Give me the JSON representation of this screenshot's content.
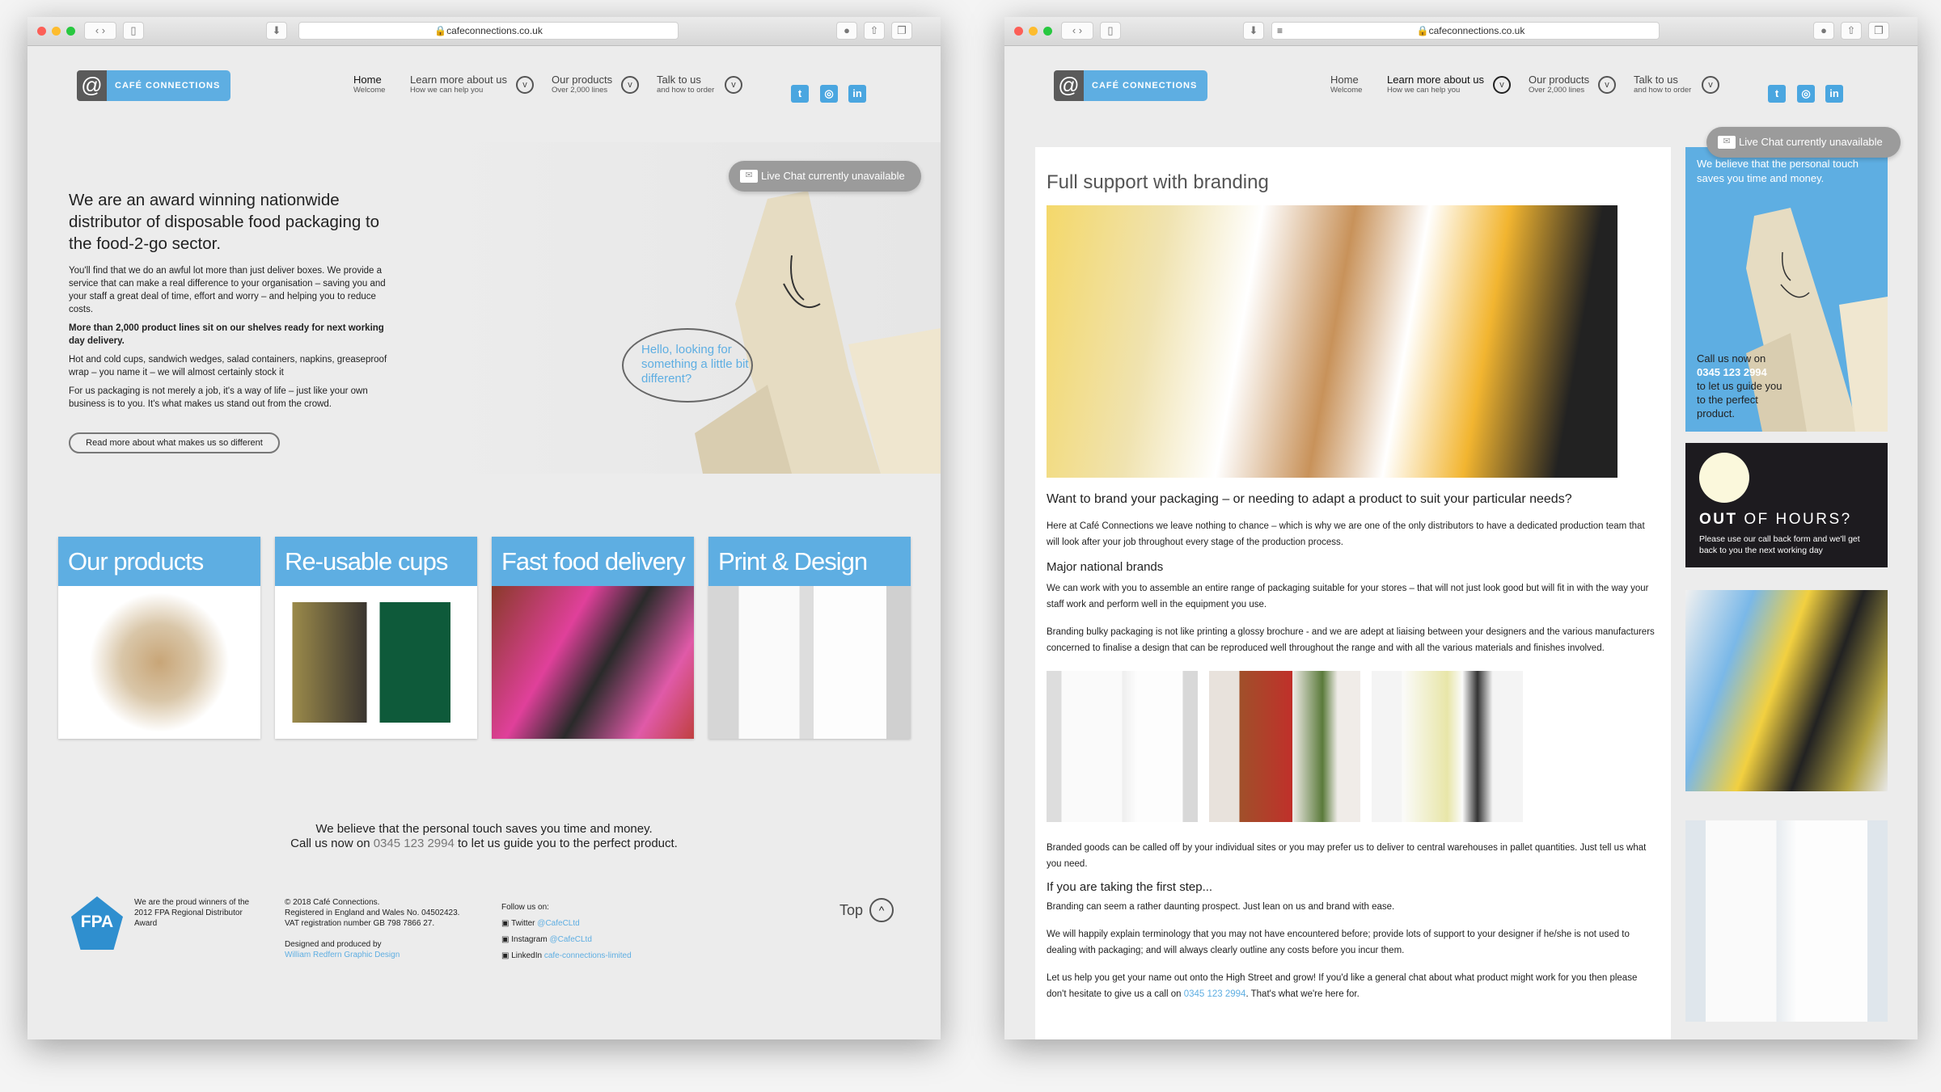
{
  "browser": {
    "url": "cafeconnections.co.uk"
  },
  "header": {
    "logo_text": "CAFÉ CONNECTIONS",
    "nav": [
      {
        "title": "Home",
        "subtitle": "Welcome"
      },
      {
        "title": "Learn more about us",
        "subtitle": "How we can help you"
      },
      {
        "title": "Our products",
        "subtitle": "Over 2,000 lines"
      },
      {
        "title": "Talk to us",
        "subtitle": "and how to order"
      }
    ],
    "social": [
      "twitter-icon",
      "instagram-icon",
      "linkedin-icon"
    ]
  },
  "live_chat": "Live Chat currently unavailable",
  "home": {
    "heading": "We are an award winning nationwide distributor of disposable food packaging to the food-2-go sector.",
    "paragraphs": [
      "You'll find that we do an awful lot more than just deliver boxes. We provide a service that can make a real difference to your organisation – saving you and your staff a great deal of time, effort and worry – and helping you to reduce costs.",
      "More than 2,000 product lines sit on our shelves ready for next working day delivery.",
      "Hot and cold cups, sandwich wedges, salad containers, napkins, greaseproof wrap – you name it – we will almost certainly stock it",
      "For us packaging is not merely a job, it's a way of life – just like your own business is to you. It's what makes us stand out from the crowd."
    ],
    "read_more": "Read more about what makes us so different",
    "speech_bubble": "Hello, looking for something a little bit different?",
    "tiles": [
      "Our products",
      "Re-usable cups",
      "Fast food delivery",
      "Print & Design"
    ],
    "tagline_1": "We believe that the personal touch saves you time and money.",
    "tagline_2a": "Call us now on ",
    "tagline_phone": "0345 123 2994",
    "tagline_2b": " to let us guide you to the perfect product.",
    "footer": {
      "fpa_logo": "FPA",
      "award": "We are the proud winners of the 2012 FPA Regional Distributor Award",
      "copyright": "© 2018 Café Connections.",
      "registered": "Registered in England and Wales No. 04502423.",
      "vat": "VAT registration number GB 798 7866 27.",
      "designed_by": "Designed and produced by",
      "designer": "William Redfern Graphic Design",
      "follow": "Follow us on:",
      "twitter_label": "Twitter",
      "twitter_handle": "@CafeCLtd",
      "instagram_label": "Instagram",
      "instagram_handle": "@CafeCLtd",
      "linkedin_label": "LinkedIn",
      "linkedin_handle": "cafe-connections-limited",
      "top": "Top"
    }
  },
  "branding": {
    "title": "Full support with branding",
    "question": "Want to brand your packaging – or needing to adapt a product to suit your particular needs?",
    "p1": "Here at Café Connections we leave nothing to chance – which is why we are one of the only distributors to have a dedicated production team that will look after your job throughout every stage of the production process.",
    "h_brands": "Major national brands",
    "p2": "We can work with you to assemble an entire range of packaging suitable for your stores – that will not just look good but will fit in with the way your staff work and perform well in the equipment you use.",
    "p3": "Branding bulky packaging is not like printing a glossy brochure - and we are adept at liaising between your designers and the various manufacturers concerned to finalise a design that can be reproduced well throughout the range and with all the various materials and finishes involved.",
    "p4": "Branded goods can be called off by your individual sites or you may prefer us to deliver to central warehouses in pallet quantities.  Just tell us what you need.",
    "h_first": "If you are taking the first step...",
    "p5": "Branding can seem a rather daunting prospect. Just lean on us and brand with ease.",
    "p6": "We will happily explain terminology that you may not have encountered before; provide lots of support to your designer if he/she is not used to dealing with packaging; and will always clearly outline any costs before you incur them.",
    "p7a": "Let us help you get your name out onto the High Street and grow! If you'd like a general chat about what product might work for you then please don't hesitate to give us a call on ",
    "p7_phone": "0345 123 2994",
    "p7b": ". That's what we're here for.",
    "sidebar": {
      "touch": "We believe that the personal touch saves you time and money.",
      "call": "Call us now on",
      "phone": "0345 123 2994",
      "guide": "to let us guide you to the perfect product.",
      "ooh_bold": "OUT",
      "ooh_rest": " OF HOURS?",
      "ooh_text": "Please use our call back form and we'll get back to you the next working day"
    }
  },
  "colors": {
    "brand_blue": "#5eaee2",
    "logo_grey": "#5a5a5a",
    "out_of_hours_bg": "#1d1b1f"
  }
}
